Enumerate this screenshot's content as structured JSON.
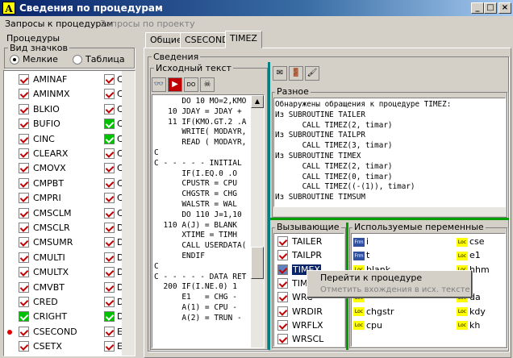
{
  "window": {
    "title": "Сведения по процедурам",
    "app_icon": "A",
    "min": "_",
    "max": "□",
    "close": "×"
  },
  "menu": {
    "items": [
      "Запросы к процедурам",
      "Запросы по проекту"
    ]
  },
  "left": {
    "title": "Процедуры",
    "view_group": "Вид значков",
    "radio_small": "Мелкие",
    "radio_table": "Таблица",
    "col1": [
      "AMINAF",
      "AMINMX",
      "BLKIO",
      "BUFIO",
      "CINC",
      "CLEARX",
      "CMOVX",
      "CMPBT",
      "CMPRI",
      "CMSCLM",
      "CMSCLR",
      "CMSUMR",
      "CMULTI",
      "CMULTX",
      "CMVBT",
      "CRED",
      "CRIGHT",
      "CSECOND",
      "CSETX"
    ],
    "col2": [
      "CS",
      "CS",
      "CS",
      "CS",
      "CS",
      "CV",
      "CY",
      "CY",
      "CY",
      "CY",
      "DI",
      "DI",
      "DI",
      "DI",
      "DF",
      "DL",
      "DL",
      "EF",
      "EX"
    ]
  },
  "tabs": [
    "Общие",
    "CSECOND",
    "TIMEZ"
  ],
  "svedenia": "Сведения",
  "source": {
    "title": "Исходный текст",
    "lines": [
      "      DO 10 MO=2,KMO",
      "   10 JDAY = JDAY +",
      "   11 IF(KMO.GT.2 .A",
      "      WRITE( MODAYR,",
      "      READ ( MODAYR,",
      "C",
      "C - - - - - INITIAL",
      "      IF(I.EQ.0 .O",
      "      CPUSTR = CPU",
      "      CHGSTR = CHG",
      "      WALSTR = WAL",
      "      DO 110 J=1,10",
      "  110 A(J) = BLANK",
      "      XTIME = TIMH",
      "      CALL USERDATA(",
      "      ENDIF",
      "C",
      "C - - - - - DATA RET",
      "  200 IF(I.NE.0) 1",
      "      E1   = CHG -",
      "      A(1) = CPU -",
      "      A(2) = TRUN -"
    ]
  },
  "raznoe": {
    "title": "Разное",
    "lines": [
      "Обнаружены обращения к процедуре TIMEZ:",
      "Из SUBROUTINE TAILER",
      "      CALL TIMEZ(2, timar)",
      "Из SUBROUTINE TAILPR",
      "      CALL TIMEZ(3, timar)",
      "Из SUBROUTINE TIMEX",
      "      CALL TIMEZ(2, timar)",
      "      CALL TIMEZ(0, timar)",
      "      CALL TIMEZ((-(1)), timar)",
      "Из SUBROUTINE TIMSUM"
    ]
  },
  "callers": {
    "title": "Вызывающие",
    "items": [
      "TAILER",
      "TAILPR",
      "TIMEX",
      "TIM",
      "WRC",
      "WRDIR",
      "WRFLX",
      "WRSCL"
    ]
  },
  "vars": {
    "title": "Используемые переменные",
    "col1": [
      {
        "tag": "Frm",
        "name": "i"
      },
      {
        "tag": "Frm",
        "name": "t"
      },
      {
        "tag": "Loc",
        "name": "blank"
      },
      {
        "tag": "Loc",
        "name": ""
      },
      {
        "tag": "Loc",
        "name": ""
      },
      {
        "tag": "Loc",
        "name": "chgstr"
      },
      {
        "tag": "Loc",
        "name": "cpu"
      }
    ],
    "col2": [
      {
        "tag": "Loc",
        "name": "cse"
      },
      {
        "tag": "Loc",
        "name": "e1"
      },
      {
        "tag": "Loc",
        "name": "hhm"
      },
      {
        "tag": "Loc",
        "name": ""
      },
      {
        "tag": "Loc",
        "name": "da"
      },
      {
        "tag": "Loc",
        "name": "kdy"
      },
      {
        "tag": "Loc",
        "name": "kh"
      }
    ]
  },
  "context_menu": {
    "items": [
      "Перейти к процедуре",
      "Отметить вхождения в исх. тексте"
    ]
  },
  "colors": {
    "title_start": "#0a246a",
    "title_end": "#a6caf0",
    "selection": "#0a246a",
    "check": "#c00000",
    "teal": "#008080",
    "yellow": "#ffff00"
  }
}
